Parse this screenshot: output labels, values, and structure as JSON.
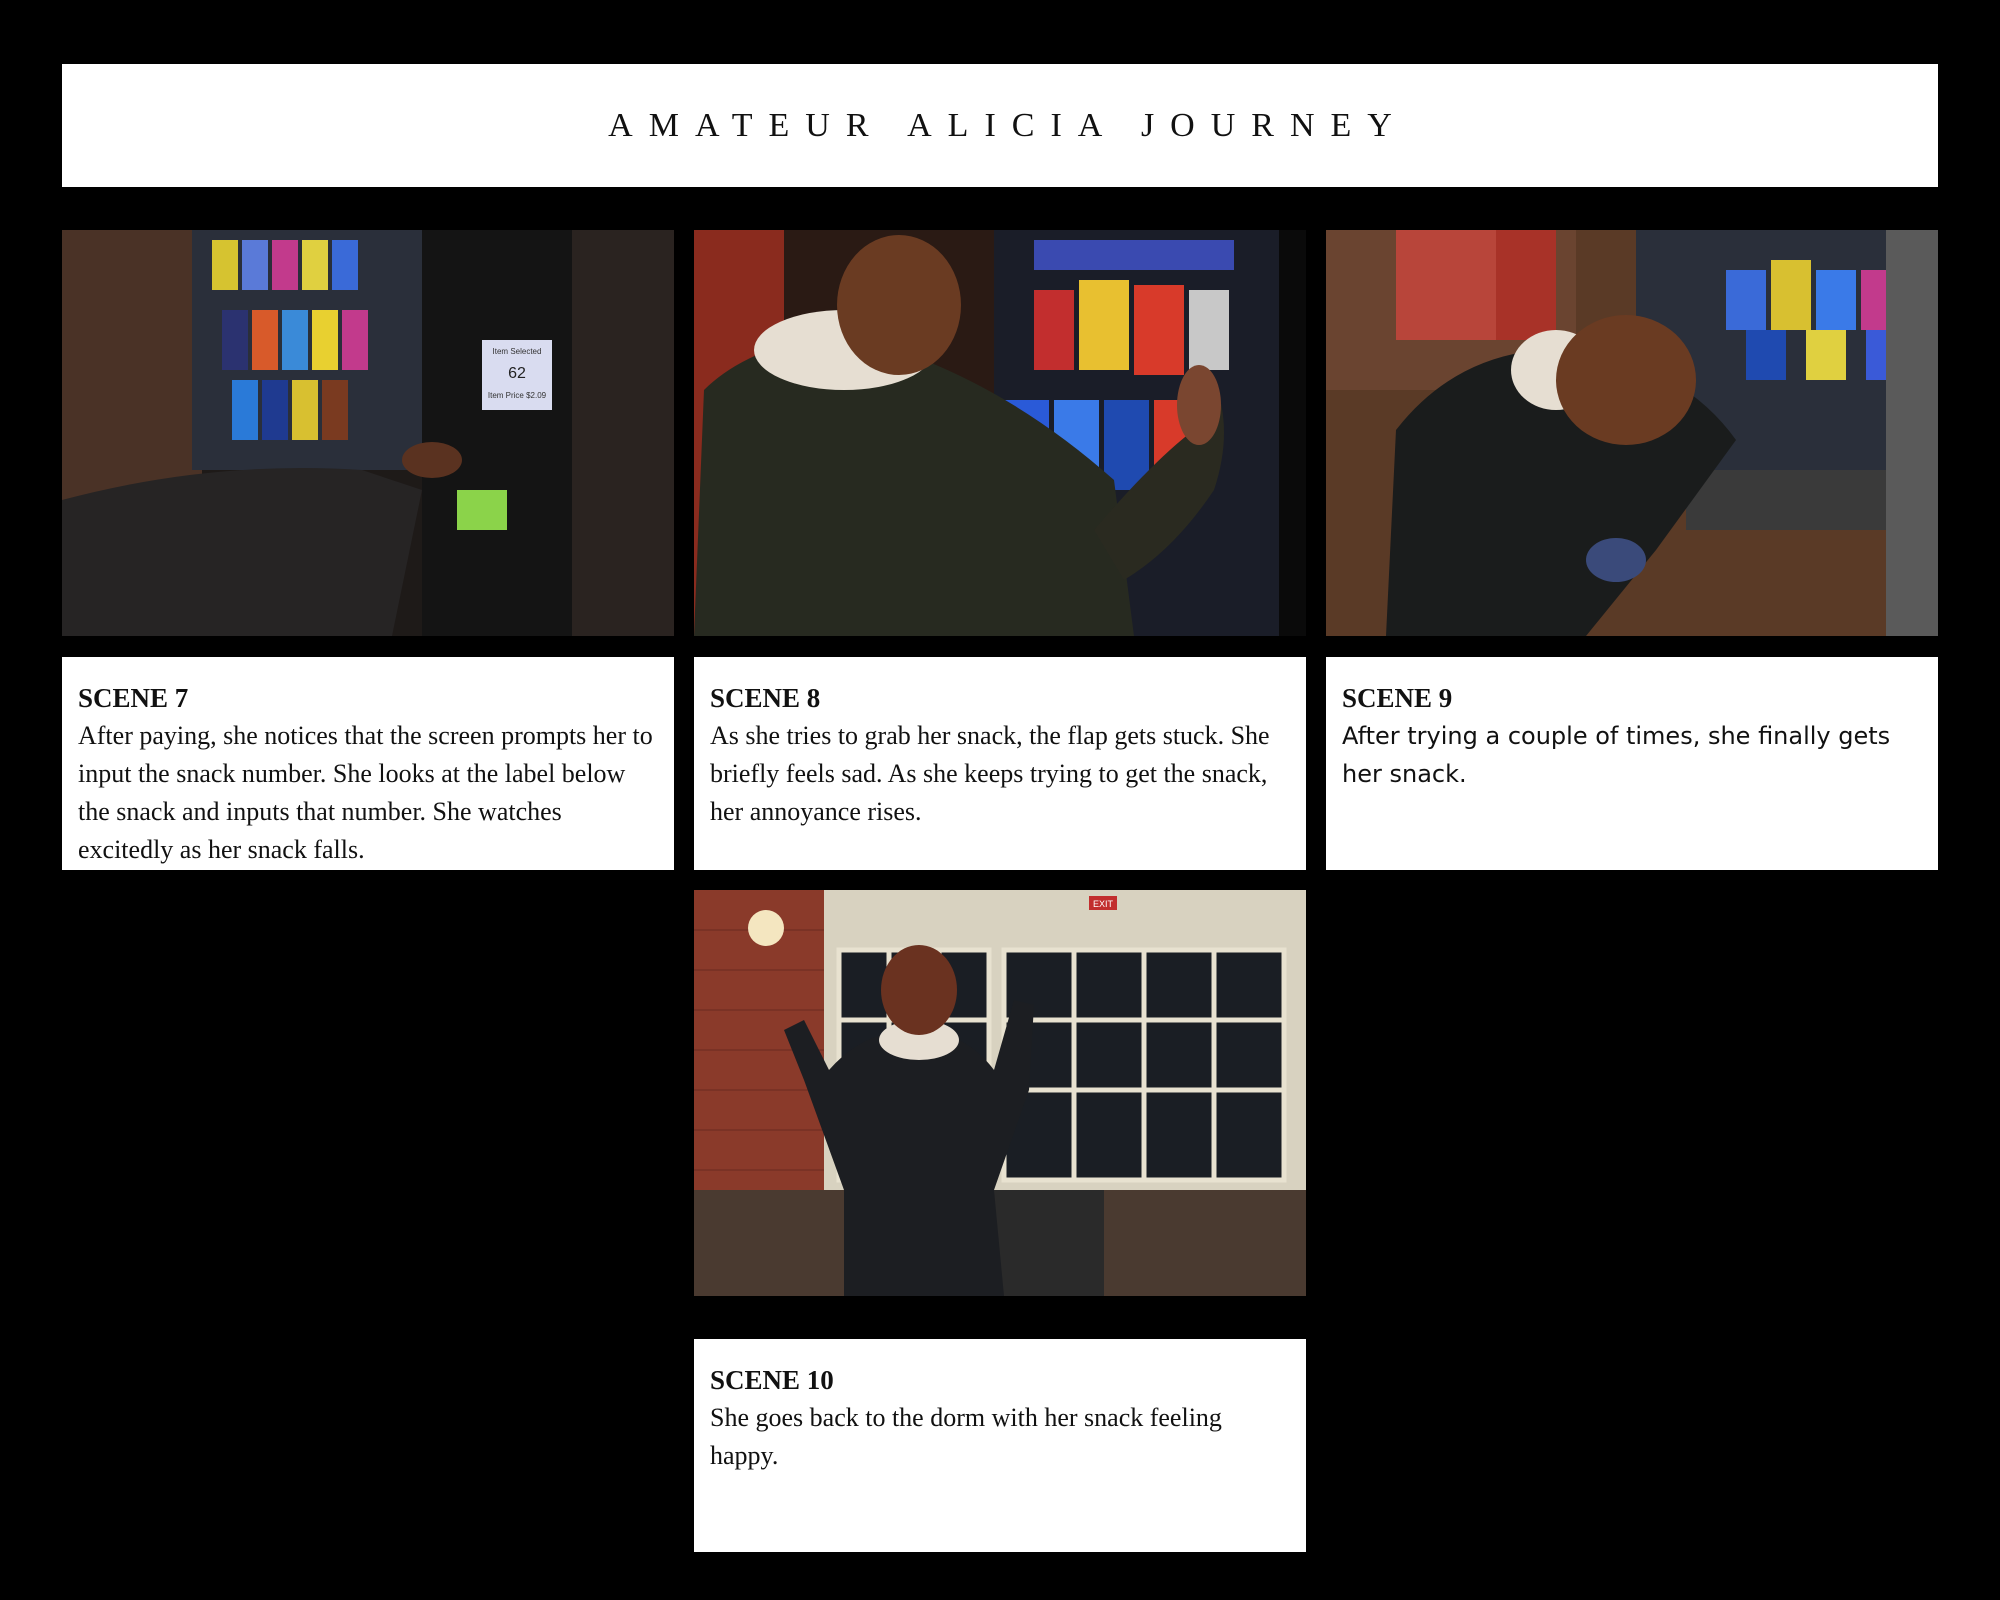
{
  "title": "AMATEUR ALICIA JOURNEY",
  "scenes": [
    {
      "heading": "SCENE 7",
      "text": "After paying, she notices that the screen prompts her to input the snack number. She looks at the label below the snack and inputs that number. She watches excitedly as her snack falls."
    },
    {
      "heading": "SCENE 8",
      "text": "As she tries to grab her snack, the flap gets stuck. She briefly feels sad. As she keeps trying to get the snack, her annoyance rises."
    },
    {
      "heading": "SCENE 9",
      "text": "After trying a couple of times, she finally gets her snack."
    },
    {
      "heading": "SCENE 10",
      "text": "She goes back to the dorm with her snack feeling happy."
    }
  ],
  "photo_text": {
    "scene7_screen_top": "Item Selected",
    "scene7_screen_number": "62",
    "scene7_screen_price": "Item Price $2.09",
    "scene10_exit": "EXIT"
  }
}
